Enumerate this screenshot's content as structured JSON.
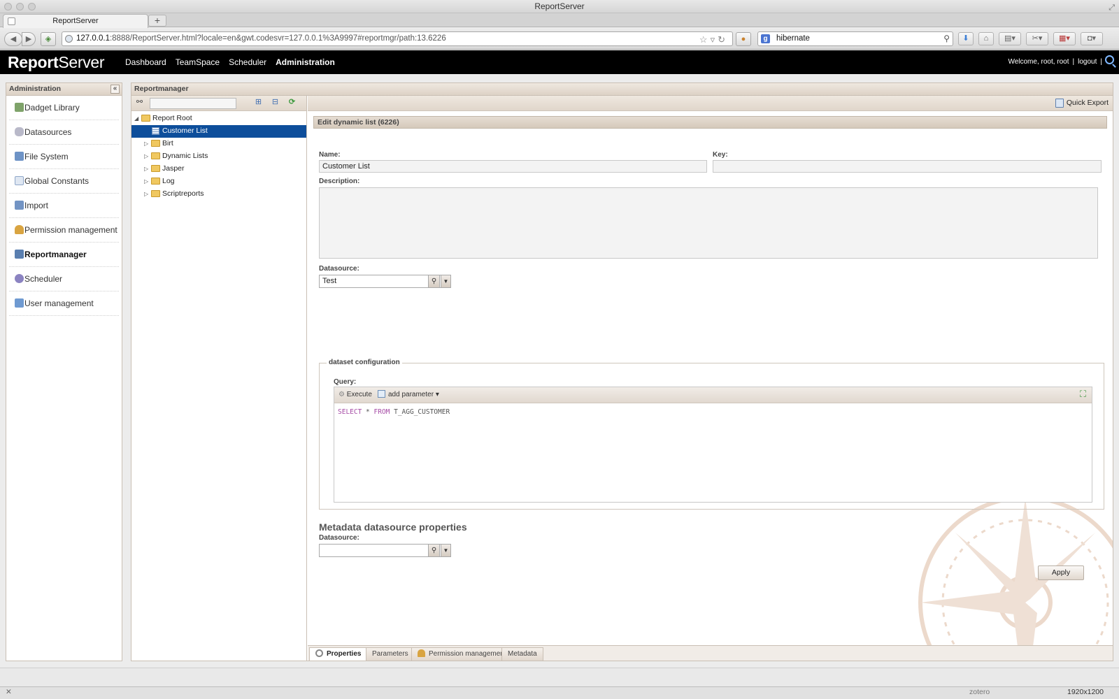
{
  "window": {
    "title": "ReportServer"
  },
  "browser": {
    "tab_title": "ReportServer",
    "new_tab": "+",
    "url_host": "127.0.0.1",
    "url_rest": ":8888/ReportServer.html?locale=en&gwt.codesvr=127.0.0.1%3A9997#reportmgr/path:13.6226",
    "search_engine": "g",
    "search_value": "hibernate",
    "status_close": "✕",
    "zotero_label": "zotero",
    "resolution": "1920x1200"
  },
  "app": {
    "logo_bold": "Report",
    "logo_normal": "Server",
    "nav": [
      "Dashboard",
      "TeamSpace",
      "Scheduler",
      "Administration"
    ],
    "active_nav": "Administration",
    "welcome": "Welcome, root, root",
    "separator": "|",
    "logout": "logout"
  },
  "admin_panel": {
    "title": "Administration",
    "collapse_icon": "«",
    "items": [
      {
        "label": "Dadget Library",
        "icon": "dadget-library-icon",
        "color": "#7fa36a"
      },
      {
        "label": "Datasources",
        "icon": "datasources-icon",
        "color": "#b9b9c9"
      },
      {
        "label": "File System",
        "icon": "file-system-icon",
        "color": "#6e93c6"
      },
      {
        "label": "Global Constants",
        "icon": "global-constants-icon",
        "color": "#8fa7c9"
      },
      {
        "label": "Import",
        "icon": "import-icon",
        "color": "#7394c4"
      },
      {
        "label": "Permission management",
        "icon": "key-icon",
        "color": "#d9a441"
      },
      {
        "label": "Reportmanager",
        "icon": "reportmanager-icon",
        "color": "#5a7fb0"
      },
      {
        "label": "Scheduler",
        "icon": "scheduler-icon",
        "color": "#8b83c1"
      },
      {
        "label": "User management",
        "icon": "user-management-icon",
        "color": "#6f9ad1"
      }
    ],
    "active_item": "Reportmanager"
  },
  "reportmanager": {
    "title": "Reportmanager",
    "tree_toolbar": {
      "find_icon": "binoculars-icon",
      "expand_icon": "⊞",
      "collapse_icon": "⊟",
      "reload_icon": "⟳"
    },
    "tree": [
      {
        "label": "Report Root",
        "level": 0,
        "type": "folder",
        "expanded": true,
        "arrow": "◢"
      },
      {
        "label": "Customer List",
        "level": 1,
        "type": "report",
        "selected": true
      },
      {
        "label": "Birt",
        "level": 1,
        "type": "folder",
        "arrow": "▷"
      },
      {
        "label": "Dynamic Lists",
        "level": 1,
        "type": "folder",
        "arrow": "▷"
      },
      {
        "label": "Jasper",
        "level": 1,
        "type": "folder",
        "arrow": "▷"
      },
      {
        "label": "Log",
        "level": 1,
        "type": "folder",
        "arrow": "▷"
      },
      {
        "label": "Scriptreports",
        "level": 1,
        "type": "folder",
        "arrow": "▷"
      }
    ],
    "quick_export": "Quick Export",
    "edit_title": "Edit dynamic list (6226)",
    "form": {
      "name_label": "Name:",
      "name_value": "Customer List",
      "key_label": "Key:",
      "key_value": "",
      "description_label": "Description:",
      "description_value": "",
      "datasource_label": "Datasource:",
      "datasource_value": "Test",
      "dataset_legend": "dataset configuration",
      "query_label": "Query:",
      "execute_label": "Execute",
      "add_parameter_label": "add parameter",
      "dropdown_caret": "▾",
      "query_kw1": "SELECT",
      "query_mid": " * ",
      "query_kw2": "FROM",
      "query_table": " T_AGG_CUSTOMER",
      "metadata_title": "Metadata datasource properties",
      "metadata_datasource_label": "Datasource:",
      "metadata_datasource_value": "",
      "apply_label": "Apply"
    },
    "bottom_tabs": [
      "Properties",
      "Parameters",
      "Permission management",
      "Metadata"
    ],
    "active_bottom_tab": "Properties"
  }
}
